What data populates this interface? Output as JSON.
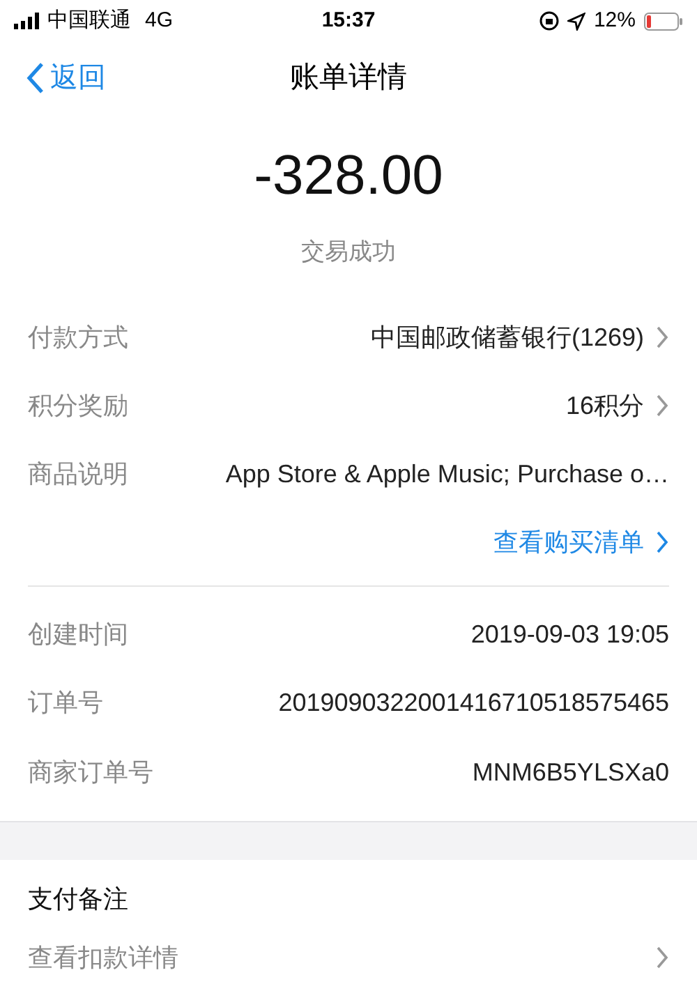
{
  "status_bar": {
    "carrier": "中国联通",
    "network": "4G",
    "time": "15:37",
    "battery": "12%"
  },
  "nav": {
    "back": "返回",
    "title": "账单详情"
  },
  "summary": {
    "amount": "-328.00",
    "status": "交易成功"
  },
  "details": [
    {
      "label": "付款方式",
      "value": "中国邮政储蓄银行(1269)",
      "chevron": true
    },
    {
      "label": "积分奖励",
      "value": "16积分",
      "chevron": true
    },
    {
      "label": "商品说明",
      "value": "App Store & Apple Music; Purchase o…",
      "chevron": false
    }
  ],
  "purchase_link": "查看购买清单",
  "order_info": [
    {
      "label": "创建时间",
      "value": "2019-09-03 19:05"
    },
    {
      "label": "订单号",
      "value": "2019090322001416710518575465"
    },
    {
      "label": "商家订单号",
      "value": "MNM6B5YLSXa0"
    }
  ],
  "remarks": {
    "title": "支付备注",
    "link": "查看扣款详情"
  }
}
